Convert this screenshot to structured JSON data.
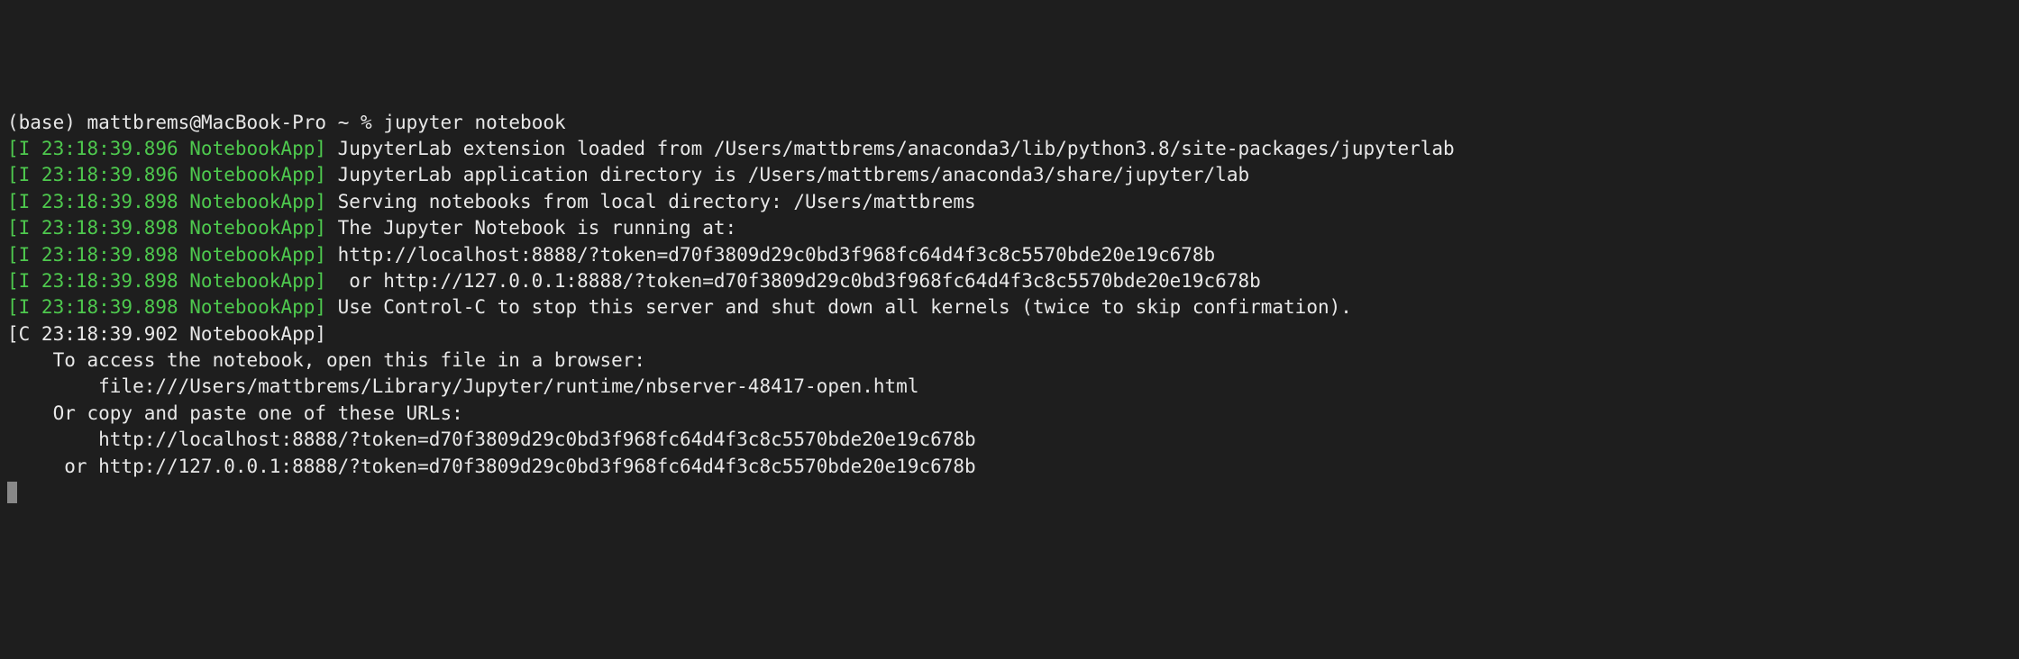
{
  "prompt": {
    "env": "(base)",
    "user": "mattbrems",
    "host": "MacBook-Pro",
    "path": "~",
    "symbol": "%",
    "command": "jupyter notebook"
  },
  "logs": [
    {
      "type": "info",
      "prefix": "[I 23:18:39.896 NotebookApp]",
      "text": " JupyterLab extension loaded from /Users/mattbrems/anaconda3/lib/python3.8/site-packages/jupyterlab"
    },
    {
      "type": "info",
      "prefix": "[I 23:18:39.896 NotebookApp]",
      "text": " JupyterLab application directory is /Users/mattbrems/anaconda3/share/jupyter/lab"
    },
    {
      "type": "info",
      "prefix": "[I 23:18:39.898 NotebookApp]",
      "text": " Serving notebooks from local directory: /Users/mattbrems"
    },
    {
      "type": "info",
      "prefix": "[I 23:18:39.898 NotebookApp]",
      "text": " The Jupyter Notebook is running at:"
    },
    {
      "type": "info",
      "prefix": "[I 23:18:39.898 NotebookApp]",
      "text": " http://localhost:8888/?token=d70f3809d29c0bd3f968fc64d4f3c8c5570bde20e19c678b"
    },
    {
      "type": "info",
      "prefix": "[I 23:18:39.898 NotebookApp]",
      "text": "  or http://127.0.0.1:8888/?token=d70f3809d29c0bd3f968fc64d4f3c8c5570bde20e19c678b"
    },
    {
      "type": "info",
      "prefix": "[I 23:18:39.898 NotebookApp]",
      "text": " Use Control-C to stop this server and shut down all kernels (twice to skip confirmation)."
    },
    {
      "type": "critical",
      "prefix": "[C 23:18:39.902 NotebookApp]",
      "text": ""
    }
  ],
  "access_info": {
    "blank": "",
    "line1": "    To access the notebook, open this file in a browser:",
    "line2": "        file:///Users/mattbrems/Library/Jupyter/runtime/nbserver-48417-open.html",
    "line3": "    Or copy and paste one of these URLs:",
    "line4": "        http://localhost:8888/?token=d70f3809d29c0bd3f968fc64d4f3c8c5570bde20e19c678b",
    "line5": "     or http://127.0.0.1:8888/?token=d70f3809d29c0bd3f968fc64d4f3c8c5570bde20e19c678b"
  }
}
